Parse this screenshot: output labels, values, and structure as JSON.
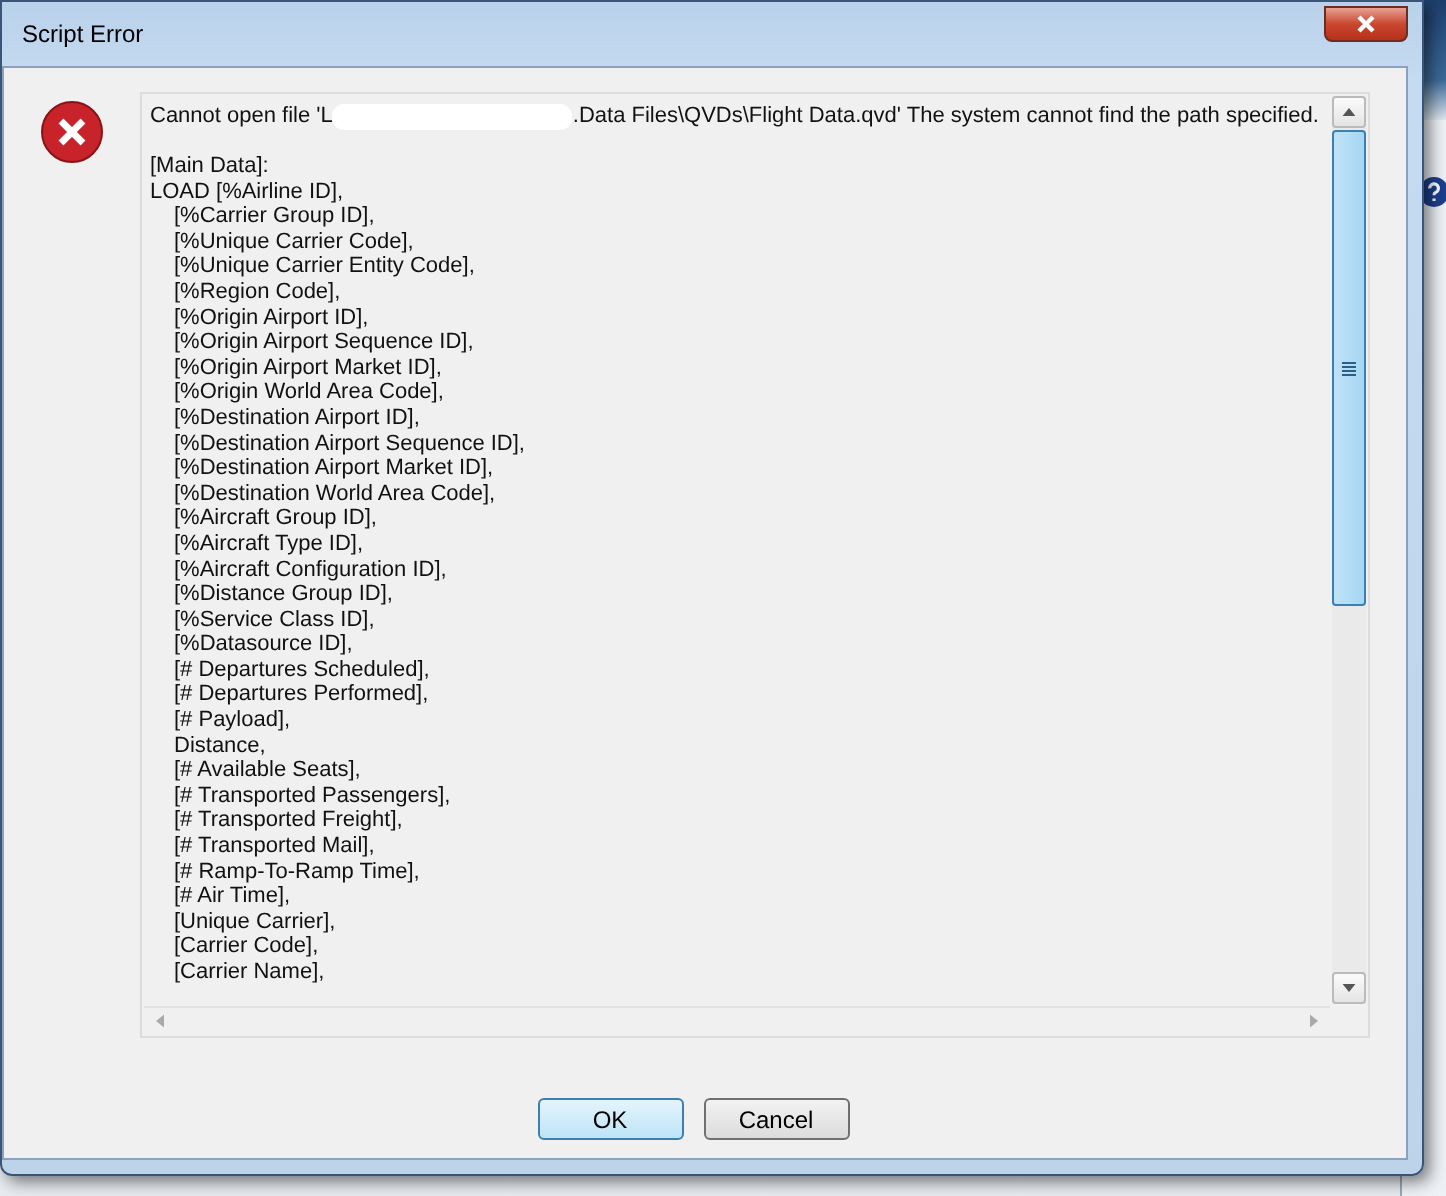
{
  "window": {
    "title": "Script Error"
  },
  "message": {
    "start": "Cannot open file 'L",
    "end": ".Data Files\\QVDs\\Flight Data.qvd' The system cannot find the path specified."
  },
  "script_lines": [
    {
      "kind": "statement",
      "text": "[Main Data]:"
    },
    {
      "kind": "statement",
      "text": "LOAD [%Airline ID],"
    },
    {
      "kind": "field",
      "text": "[%Carrier Group ID],"
    },
    {
      "kind": "field",
      "text": "[%Unique Carrier Code],"
    },
    {
      "kind": "field",
      "text": "[%Unique Carrier Entity Code],"
    },
    {
      "kind": "field",
      "text": "[%Region Code],"
    },
    {
      "kind": "field",
      "text": "[%Origin Airport ID],"
    },
    {
      "kind": "field",
      "text": "[%Origin Airport Sequence ID],"
    },
    {
      "kind": "field",
      "text": "[%Origin Airport Market ID],"
    },
    {
      "kind": "field",
      "text": "[%Origin World Area Code],"
    },
    {
      "kind": "field",
      "text": "[%Destination Airport ID],"
    },
    {
      "kind": "field",
      "text": "[%Destination Airport Sequence ID],"
    },
    {
      "kind": "field",
      "text": "[%Destination Airport Market ID],"
    },
    {
      "kind": "field",
      "text": "[%Destination World Area Code],"
    },
    {
      "kind": "field",
      "text": "[%Aircraft Group ID],"
    },
    {
      "kind": "field",
      "text": "[%Aircraft Type ID],"
    },
    {
      "kind": "field",
      "text": "[%Aircraft Configuration ID],"
    },
    {
      "kind": "field",
      "text": "[%Distance Group ID],"
    },
    {
      "kind": "field",
      "text": "[%Service Class ID],"
    },
    {
      "kind": "field",
      "text": "[%Datasource ID],"
    },
    {
      "kind": "field",
      "text": "[# Departures Scheduled],"
    },
    {
      "kind": "field",
      "text": "[# Departures Performed],"
    },
    {
      "kind": "field",
      "text": "[# Payload],"
    },
    {
      "kind": "field",
      "text": "Distance,"
    },
    {
      "kind": "field",
      "text": "[# Available Seats],"
    },
    {
      "kind": "field",
      "text": "[# Transported Passengers],"
    },
    {
      "kind": "field",
      "text": "[# Transported Freight],"
    },
    {
      "kind": "field",
      "text": "[# Transported Mail],"
    },
    {
      "kind": "field",
      "text": "[# Ramp-To-Ramp Time],"
    },
    {
      "kind": "field",
      "text": "[# Air Time],"
    },
    {
      "kind": "field",
      "text": "[Unique Carrier],"
    },
    {
      "kind": "field",
      "text": "[Carrier Code],"
    },
    {
      "kind": "field",
      "text": "[Carrier Name],"
    }
  ],
  "buttons": [
    {
      "label": "OK",
      "default": true
    },
    {
      "label": "Cancel",
      "default": false
    }
  ]
}
